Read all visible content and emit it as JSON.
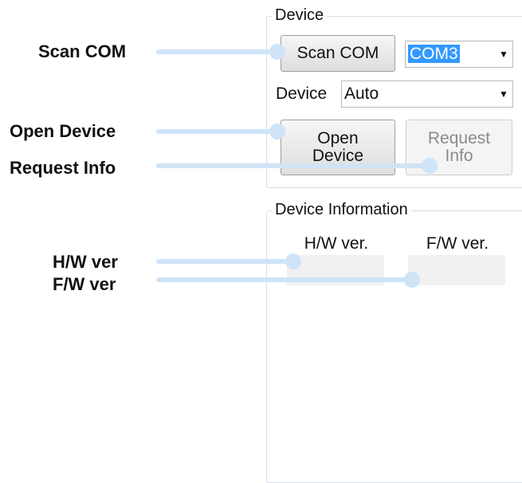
{
  "device_group": {
    "title": "Device",
    "scan_button": "Scan COM",
    "com_port": "COM3",
    "device_label": "Device",
    "device_type": "Auto",
    "open_button": "Open\nDevice",
    "request_button": "Request\nInfo",
    "request_enabled": false
  },
  "info_group": {
    "title": "Device Information",
    "hw_header": "H/W ver.",
    "fw_header": "F/W ver.",
    "hw_value": "",
    "fw_value": ""
  },
  "callouts": {
    "scan_com": "Scan COM",
    "open_device": "Open Device",
    "request_info": "Request Info",
    "hw_ver": "H/W ver",
    "fw_ver": "F/W ver"
  },
  "icons": {
    "dropdown": "chevron-down-icon"
  },
  "colors": {
    "callout_line": "#cfe4f7",
    "selection": "#3399ff"
  }
}
